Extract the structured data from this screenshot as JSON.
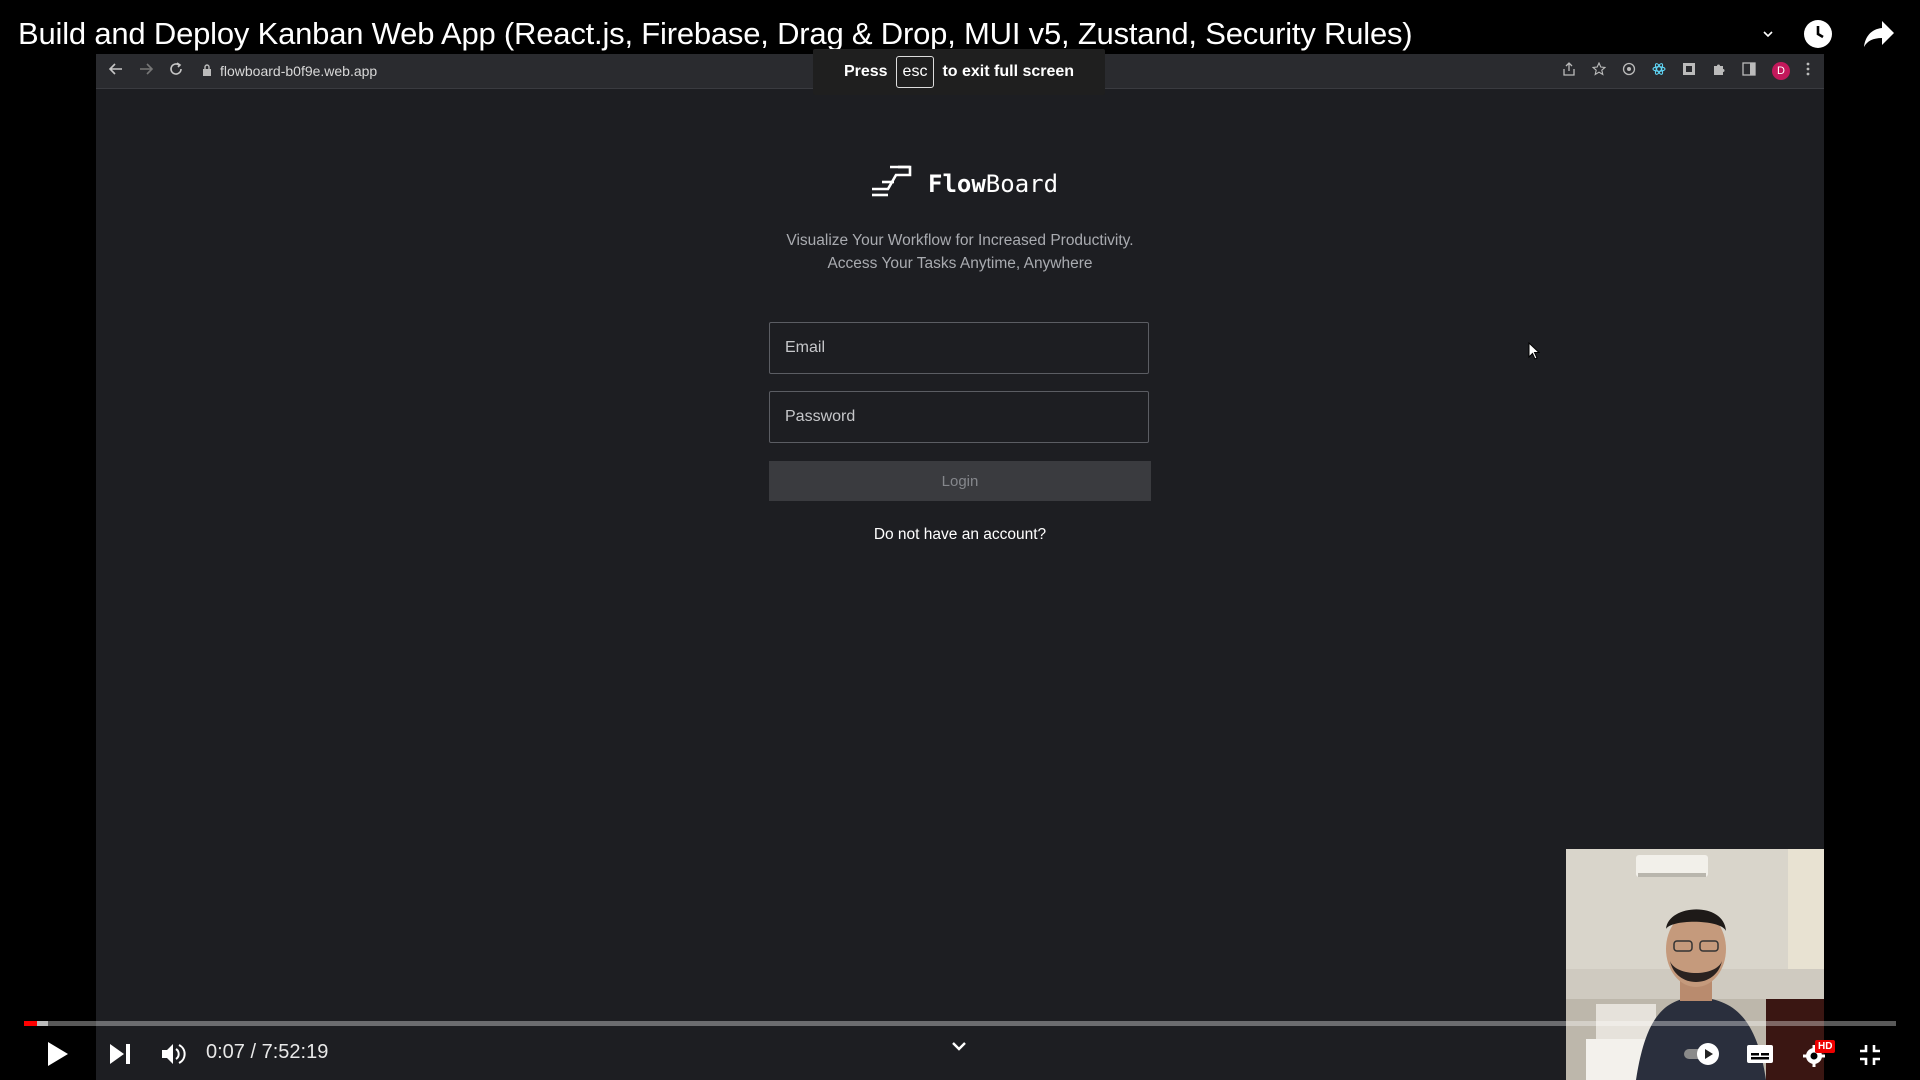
{
  "video": {
    "title": "Build and Deploy Kanban Web App (React.js, Firebase, Drag & Drop, MUI v5, Zustand, Security Rules)",
    "current_time": "0:07",
    "duration": "7:52:19",
    "time_display": "0:07 / 7:52:19",
    "progress_fraction": 0.007,
    "hd_badge": "HD"
  },
  "browser": {
    "url": "flowboard-b0f9e.web.app",
    "profile_initial": "D"
  },
  "fullscreen_toast": {
    "prefix": "Press",
    "key": "esc",
    "suffix": "to exit full screen"
  },
  "app": {
    "brand_bold": "Flow",
    "brand_rest": "Board",
    "tagline_line1": "Visualize Your Workflow for Increased Productivity.",
    "tagline_line2": "Access Your Tasks Anytime, Anywhere",
    "email_placeholder": "Email",
    "password_placeholder": "Password",
    "login_label": "Login",
    "signup_link": "Do not have an account?"
  },
  "colors": {
    "app_background": "#1d1e22",
    "progress_played": "#ff0000",
    "avatar": "#c2185b"
  }
}
